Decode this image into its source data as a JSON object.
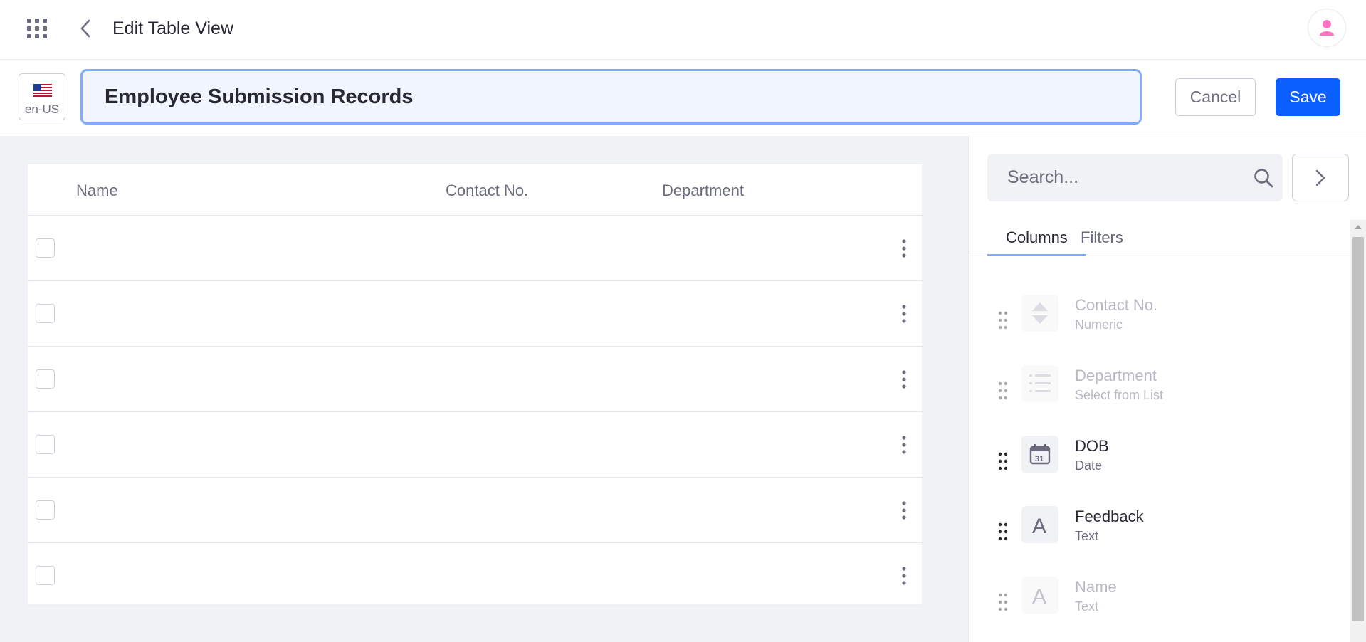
{
  "header": {
    "title": "Edit Table View"
  },
  "titlebar": {
    "language_label": "en-US",
    "view_name": "Employee Submission Records",
    "cancel_label": "Cancel",
    "save_label": "Save"
  },
  "table": {
    "columns": [
      "Name",
      "Contact No.",
      "Department"
    ],
    "row_count": 6
  },
  "sidebar": {
    "search_placeholder": "Search...",
    "tabs": [
      {
        "label": "Columns",
        "active": true
      },
      {
        "label": "Filters",
        "active": false
      }
    ],
    "fields": [
      {
        "name": "Contact No.",
        "type": "Numeric",
        "icon": "numeric-icon",
        "disabled": true
      },
      {
        "name": "Department",
        "type": "Select from List",
        "icon": "list-icon",
        "disabled": true
      },
      {
        "name": "DOB",
        "type": "Date",
        "icon": "calendar-icon",
        "disabled": false
      },
      {
        "name": "Feedback",
        "type": "Text",
        "icon": "text-icon",
        "disabled": false
      },
      {
        "name": "Name",
        "type": "Text",
        "icon": "text-icon",
        "disabled": true
      }
    ]
  },
  "colors": {
    "accent": "#0b5fff",
    "focus_border": "#80acff",
    "canvas_bg": "#f1f2f5",
    "avatar": "#ff73c3"
  }
}
